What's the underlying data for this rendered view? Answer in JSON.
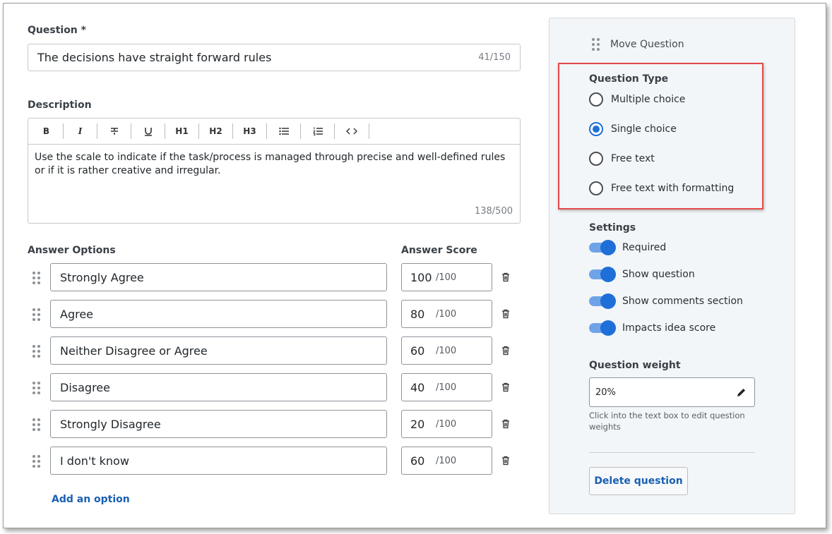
{
  "question": {
    "label": "Question *",
    "value": "The decisions have straight forward rules",
    "count": "41/150"
  },
  "description": {
    "label": "Description",
    "toolbar": [
      "B",
      "I",
      "S",
      "U",
      "H1",
      "H2",
      "H3",
      "bullet-list",
      "numbered-list",
      "code"
    ],
    "text": "Use the scale to indicate if the task/process is managed through precise and well-defined rules or if it is rather creative and irregular.",
    "count": "138/500"
  },
  "answers": {
    "options_label": "Answer Options",
    "score_label": "Answer Score",
    "items": [
      {
        "text": "Strongly Agree",
        "score": "100",
        "max": "/100"
      },
      {
        "text": "Agree",
        "score": "80",
        "max": "/100"
      },
      {
        "text": "Neither Disagree or Agree",
        "score": "60",
        "max": "/100"
      },
      {
        "text": "Disagree",
        "score": "40",
        "max": "/100"
      },
      {
        "text": "Strongly Disagree",
        "score": "20",
        "max": "/100"
      },
      {
        "text": "I don't know",
        "score": "60",
        "max": "/100"
      }
    ],
    "add_option": "Add an option"
  },
  "panel": {
    "move": "Move Question",
    "type_label": "Question Type",
    "types": [
      {
        "label": "Multiple choice",
        "selected": false
      },
      {
        "label": "Single choice",
        "selected": true
      },
      {
        "label": "Free text",
        "selected": false
      },
      {
        "label": "Free text with formatting",
        "selected": false
      }
    ],
    "settings_label": "Settings",
    "settings": [
      {
        "label": "Required",
        "on": true
      },
      {
        "label": "Show question",
        "on": true
      },
      {
        "label": "Show comments section",
        "on": true
      },
      {
        "label": "Impacts idea score",
        "on": true
      }
    ],
    "weight_label": "Question weight",
    "weight_value": "20%",
    "weight_hint": "Click into the text box to edit question weights",
    "delete_label": "Delete question"
  },
  "colors": {
    "accent": "#1f6fd8",
    "link": "#1a5fb4",
    "highlight": "#e34848"
  }
}
